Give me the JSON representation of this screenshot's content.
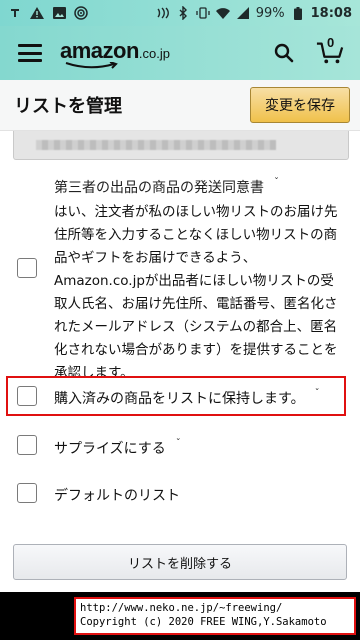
{
  "status_bar": {
    "battery_percent": "99%",
    "time": "18:08",
    "left_icons": [
      "t-icon",
      "alert-icon",
      "image-icon",
      "cast-icon"
    ],
    "right_icons": [
      "nfc-icon",
      "bluetooth-icon",
      "vibrate-icon",
      "wifi-icon",
      "signal-icon",
      "battery-icon"
    ]
  },
  "appbar": {
    "logo_main": "amazon",
    "logo_suffix": ".co.jp",
    "cart_count": "0"
  },
  "page": {
    "title": "リストを管理",
    "save_button": "変更を保存"
  },
  "consent": {
    "title": "第三者の出品の商品の発送同意書",
    "text": "はい、注文者が私のほしい物リストのお届け先住所等を入力することなくほしい物リストの商品やギフトをお届けできるよう、Amazon.co.jpが出品者にほしい物リストの受取人氏名、お届け先住所、電話番号、匿名化されたメールアドレス（システムの都合上、匿名化されない場合があります）を提供することを承認します。"
  },
  "options": {
    "keep_purchased": "購入済みの商品をリストに保持します。",
    "surprise": "サプライズにする",
    "default_list": "デフォルトのリスト"
  },
  "delete_button": "リストを削除する",
  "copyright": {
    "line1": "http://www.neko.ne.jp/~freewing/",
    "line2": "Copyright (c) 2020 FREE WING,Y.Sakamoto"
  },
  "colors": {
    "header_gradient_start": "#84d8cf",
    "header_gradient_end": "#a6e5d9",
    "save_button": "#f0c14b",
    "highlight_border": "#e01010"
  }
}
